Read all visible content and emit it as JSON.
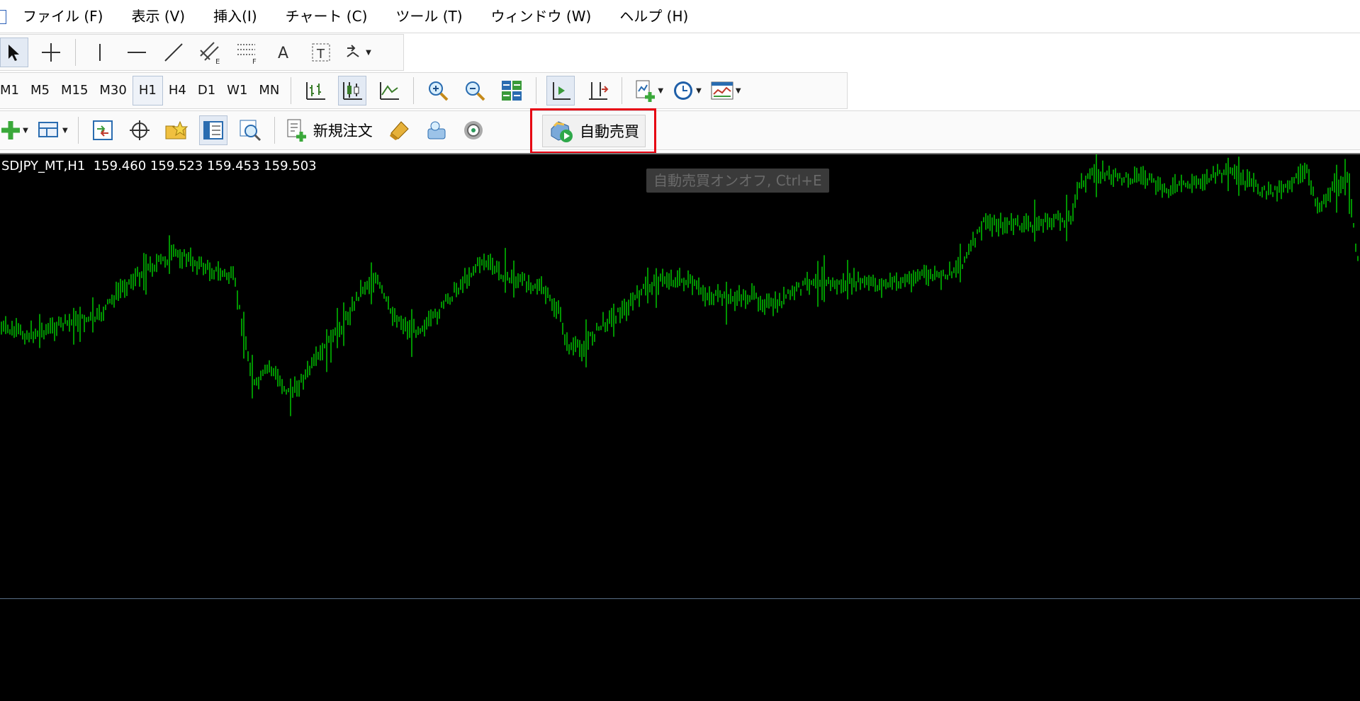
{
  "menu": [
    {
      "label": "ファイル (F)"
    },
    {
      "label": "表示 (V)"
    },
    {
      "label": "挿入(I)"
    },
    {
      "label": "チャート (C)"
    },
    {
      "label": "ツール (T)"
    },
    {
      "label": "ウィンドウ (W)"
    },
    {
      "label": "ヘルプ (H)"
    }
  ],
  "timeframes": [
    "M1",
    "M5",
    "M15",
    "M30",
    "H1",
    "H4",
    "D1",
    "W1",
    "MN"
  ],
  "active_timeframe": "H1",
  "toolbar3": {
    "new_order_label": "新規注文",
    "auto_trade_label": "自動売買"
  },
  "chart": {
    "symbol_info": "SDJPY_MT,H1  159.460 159.523 159.453 159.503",
    "tooltip": "自動売買オンオフ, Ctrl+E",
    "colors": {
      "background": "#000000",
      "bars": "#00d400",
      "text": "#ffffff",
      "highlight": "#e60012"
    }
  },
  "icons": {
    "toolbar1": [
      "cursor-icon",
      "crosshair-icon",
      "vertical-line-icon",
      "horizontal-line-icon",
      "trendline-icon",
      "equidistant-channel-icon",
      "fibonacci-icon",
      "text-icon",
      "text-label-icon",
      "arrows-icon"
    ],
    "toolbar2": [
      "bar-chart-icon",
      "candlestick-icon",
      "line-chart-icon",
      "zoom-in-icon",
      "zoom-out-icon",
      "tile-windows-icon",
      "auto-scroll-icon",
      "chart-shift-icon",
      "indicators-icon",
      "periods-icon",
      "templates-icon"
    ],
    "toolbar3": [
      "new-chart-icon",
      "profiles-icon",
      "market-watch-icon",
      "data-window-icon",
      "navigator-icon",
      "terminal-icon",
      "strategy-tester-icon",
      "new-order-icon",
      "metaeditor-icon",
      "options-icon",
      "signals-icon",
      "auto-trading-icon"
    ]
  }
}
